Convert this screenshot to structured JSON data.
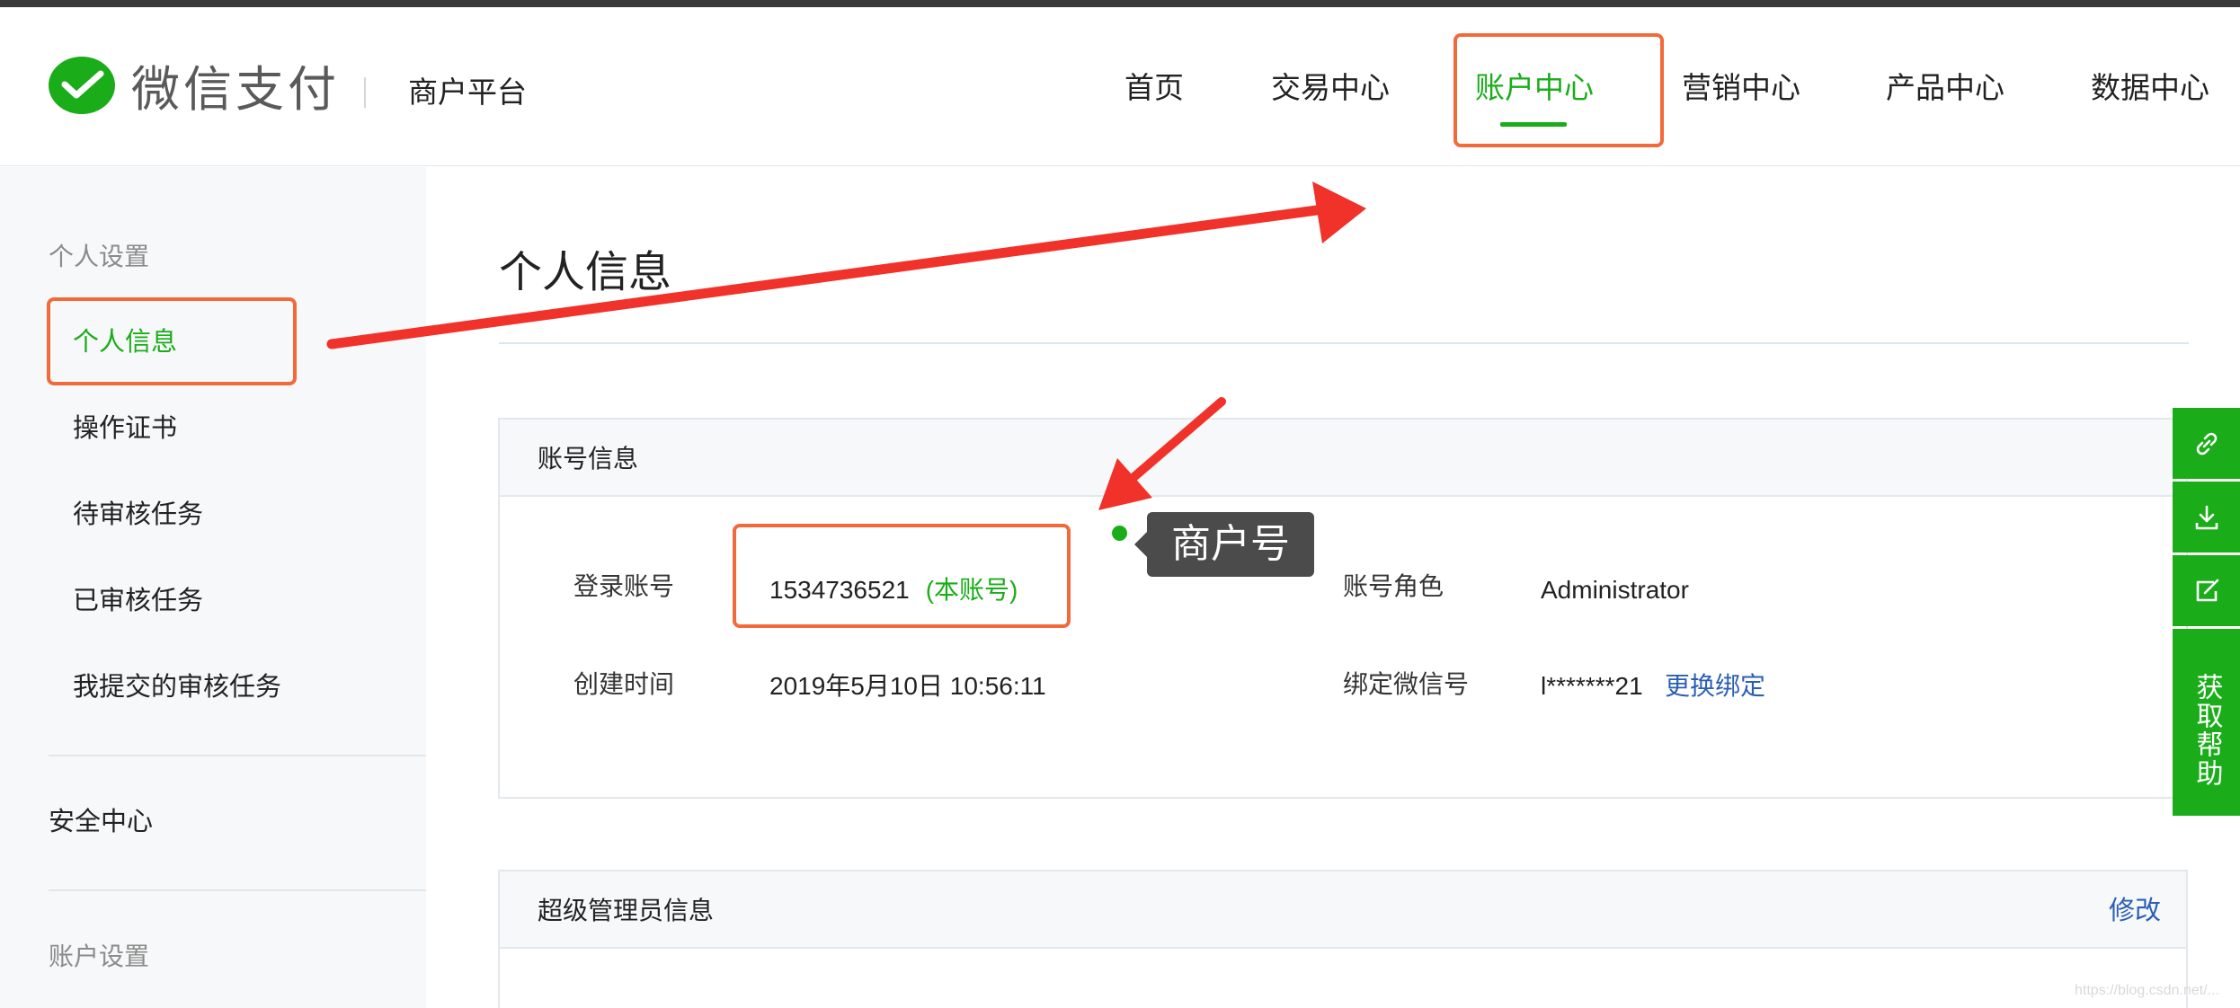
{
  "brand": {
    "name": "微信支付",
    "platform": "商户平台"
  },
  "nav": {
    "items": [
      "首页",
      "交易中心",
      "账户中心",
      "营销中心",
      "产品中心",
      "数据中心"
    ],
    "active": "账户中心"
  },
  "sidebar": {
    "group_personal": "个人设置",
    "items": [
      "个人信息",
      "操作证书",
      "待审核任务",
      "已审核任务",
      "我提交的审核任务"
    ],
    "active": "个人信息",
    "security": "安全中心",
    "group_account": "账户设置"
  },
  "page": {
    "title": "个人信息"
  },
  "account_info": {
    "title": "账号信息",
    "login_label": "登录账号",
    "login_value": "1534736521",
    "login_tag": "(本账号)",
    "created_label": "创建时间",
    "created_value": "2019年5月10日 10:56:11",
    "role_label": "账号角色",
    "role_value": "Administrator",
    "wechat_label": "绑定微信号",
    "wechat_value": "l*******21",
    "rebind_link": "更换绑定"
  },
  "admin_info": {
    "title": "超级管理员信息",
    "edit_link": "修改"
  },
  "annotation": {
    "tooltip": "商户号"
  },
  "float_toolbar": {
    "icons": [
      "link-icon",
      "download-icon",
      "edit-icon"
    ],
    "help_label": "获取帮助"
  },
  "watermark": "https://blog.csdn.net/...",
  "colors": {
    "accent_green": "#1aad19",
    "highlight_orange": "#f26a3a",
    "annotation_red": "#f0322a",
    "link_blue": "#2b5fb4"
  }
}
